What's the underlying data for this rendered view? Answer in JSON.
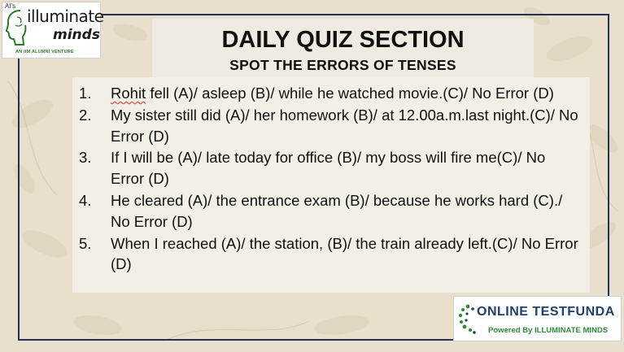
{
  "logo": {
    "top_text": "AI's",
    "word1": "illuminate",
    "word2": "minds",
    "tagline": "AN IIM ALUMNI VENTURE"
  },
  "header": {
    "title": "DAILY QUIZ SECTION",
    "subtitle": "SPOT THE ERRORS OF TENSES"
  },
  "questions": [
    {
      "num": "1.",
      "first_word": "Rohit",
      "rest": " fell (A)/ asleep (B)/ while he watched movie.(C)/ No Error (D)"
    },
    {
      "num": "2.",
      "text": "My sister still did (A)/ her homework (B)/ at 12.00a.m.last night.(C)/ No Error (D)"
    },
    {
      "num": "3.",
      "text": "If I will be (A)/ late today for office (B)/ my boss will fire me(C)/ No Error (D)"
    },
    {
      "num": "4.",
      "text": "He cleared (A)/ the entrance exam (B)/ because he works hard (C)./ No Error (D)"
    },
    {
      "num": "5.",
      "text": "When I reached (A)/ the station, (B)/ the train already left.(C)/ No Error (D)"
    }
  ],
  "footer_logo": {
    "brand": "ONLINE TESTFUNDA",
    "powered": "Powered By ILLUMINATE MINDS"
  },
  "colors": {
    "frame": "#24305a",
    "brand_blue": "#1f3f6e",
    "brand_green": "#2e8b3a"
  }
}
